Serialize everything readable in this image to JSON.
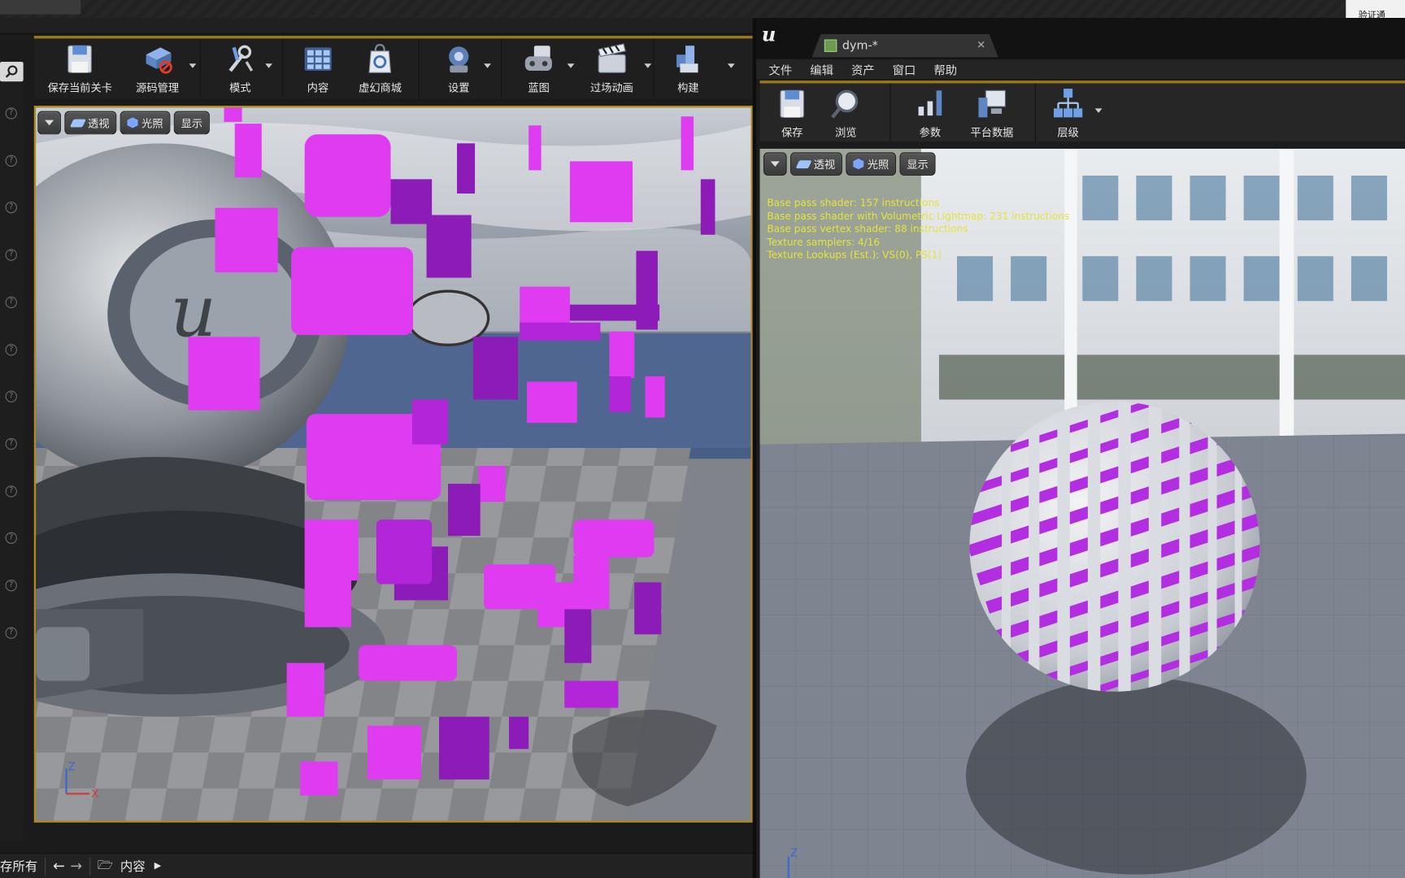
{
  "top_strip": {
    "right_text": "验证通"
  },
  "left_toolbar": {
    "buttons": [
      {
        "label": "保存当前关卡",
        "icon": "save-icon"
      },
      {
        "label": "源码管理",
        "icon": "source-control-icon"
      },
      {
        "label": "模式",
        "icon": "modes-icon"
      },
      {
        "label": "内容",
        "icon": "content-icon"
      },
      {
        "label": "虚幻商城",
        "icon": "marketplace-icon"
      },
      {
        "label": "设置",
        "icon": "settings-icon"
      },
      {
        "label": "蓝图",
        "icon": "blueprint-icon"
      },
      {
        "label": "过场动画",
        "icon": "cinematics-icon"
      },
      {
        "label": "构建",
        "icon": "build-icon"
      }
    ]
  },
  "left_viewport": {
    "view_mode_perspective": "透视",
    "view_mode_lit": "光照",
    "show_label": "显示",
    "axis_z": "Z",
    "axis_x": "X"
  },
  "content_bar": {
    "left_text": "存所有",
    "path_label": "内容"
  },
  "material_editor": {
    "tab_title": "dym-*",
    "menu": [
      "文件",
      "编辑",
      "资产",
      "窗口",
      "帮助"
    ],
    "toolbar": [
      {
        "label": "保存",
        "icon": "save-icon"
      },
      {
        "label": "浏览",
        "icon": "browse-icon"
      },
      {
        "label": "参数",
        "icon": "parameters-icon"
      },
      {
        "label": "平台数据",
        "icon": "platform-stats-icon"
      },
      {
        "label": "层级",
        "icon": "hierarchy-icon"
      }
    ],
    "viewport": {
      "view_mode_perspective": "透视",
      "view_mode_lit": "光照",
      "show_label": "显示",
      "axis_z": "Z",
      "stats": [
        "Base pass shader: 157 instructions",
        "Base pass shader with Volumetric Lightmap: 231 instructions",
        "Base pass vertex shader: 88 instructions",
        "Texture samplers: 4/16",
        "Texture Lookups (Est.): VS(0), PS(1)"
      ]
    }
  },
  "colors": {
    "magenta": "#e040f0",
    "accent_border": "#b08a1c",
    "stats_text": "#e8e23a"
  }
}
